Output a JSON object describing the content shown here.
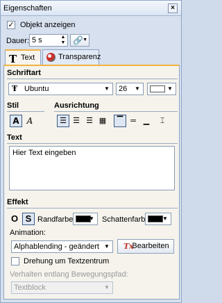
{
  "window": {
    "title": "Eigenschaften",
    "close_glyph": "×"
  },
  "show_object": {
    "label": "Objekt anzeigen",
    "checked": true
  },
  "duration": {
    "label": "Dauer:",
    "value": "5 s"
  },
  "tabs": [
    {
      "label": "Text",
      "icon": "T"
    },
    {
      "label": "Transparenz",
      "icon": "transparency-icon"
    }
  ],
  "font": {
    "section": "Schriftart",
    "family": "Ubuntu",
    "size": "26",
    "color": "#ffffff"
  },
  "style": {
    "label": "Stil",
    "bold_glyph": "A",
    "italic_glyph": "A"
  },
  "alignment": {
    "label": "Ausrichtung"
  },
  "text": {
    "section": "Text",
    "value": "Hier Text eingeben"
  },
  "effect": {
    "section": "Effekt",
    "border_color_label": "Randfarbe:",
    "border_color": "#000000",
    "shadow_color_label": "Schattenfarbe:",
    "shadow_color": "#000000"
  },
  "animation": {
    "label": "Animation:",
    "value": "Alphablending - geändert",
    "edit_button": "Bearbeiten",
    "edit_icon_glyph": "Tx"
  },
  "rotate_center": {
    "label": "Drehung um Textzentrum",
    "checked": false
  },
  "path_behavior": {
    "label": "Verhalten entlang Bewegungspfad:",
    "value": "Textblock"
  }
}
